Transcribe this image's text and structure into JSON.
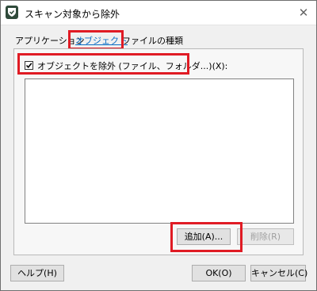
{
  "window": {
    "title": "スキャン対象から除外",
    "app_icon": "shield-icon",
    "close_glyph": "✕"
  },
  "tabs": [
    {
      "label": "アプリケーション",
      "active": false
    },
    {
      "label": "オブジェクト",
      "active": true
    },
    {
      "label": "ファイルの種類",
      "active": false
    }
  ],
  "objects_panel": {
    "checkbox_label": "オブジェクトを除外 (ファイル、フォルダ...)(X):",
    "checkbox_checked": true,
    "list_items": [],
    "add_button": "追加(A)...",
    "remove_button": "削除(R)"
  },
  "footer": {
    "help_button": "ヘルプ(H)",
    "ok_button": "OK(O)",
    "cancel_button": "キャンセル(C)"
  },
  "colors": {
    "highlight_red": "#e01b24",
    "active_tab_blue": "#0a6cc4",
    "icon_green": "#2f4a3a"
  }
}
